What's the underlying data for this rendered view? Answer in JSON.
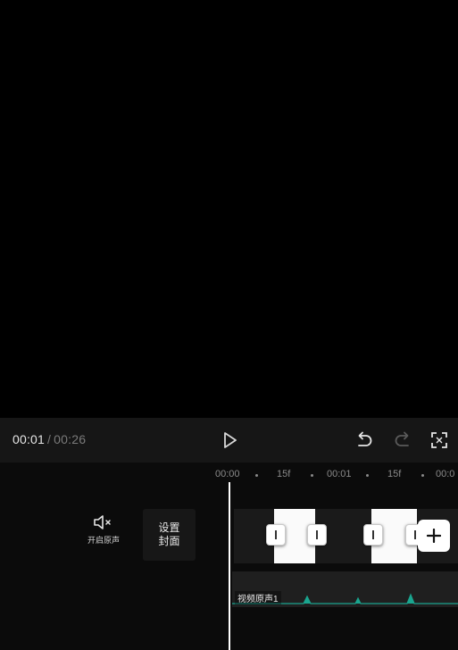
{
  "player": {
    "current_time": "00:01",
    "separator": "/",
    "total_time": "00:26"
  },
  "icons": {
    "play": "play-icon",
    "undo": "undo-icon",
    "redo": "redo-icon",
    "fullscreen": "fullscreen-icon",
    "mute": "speaker-muted-icon",
    "add": "plus-icon"
  },
  "ruler": {
    "labels": [
      "00:00",
      "15f",
      "00:01",
      "15f",
      "00:0"
    ]
  },
  "tools": {
    "mute_label": "开启原声",
    "cover_line1": "设置",
    "cover_line2": "封面"
  },
  "audio": {
    "track_label": "视频原声1"
  },
  "colors": {
    "waveform": "#1aa58f",
    "control_bar_bg": "#161616",
    "redo_disabled": "#5a5a5a"
  }
}
